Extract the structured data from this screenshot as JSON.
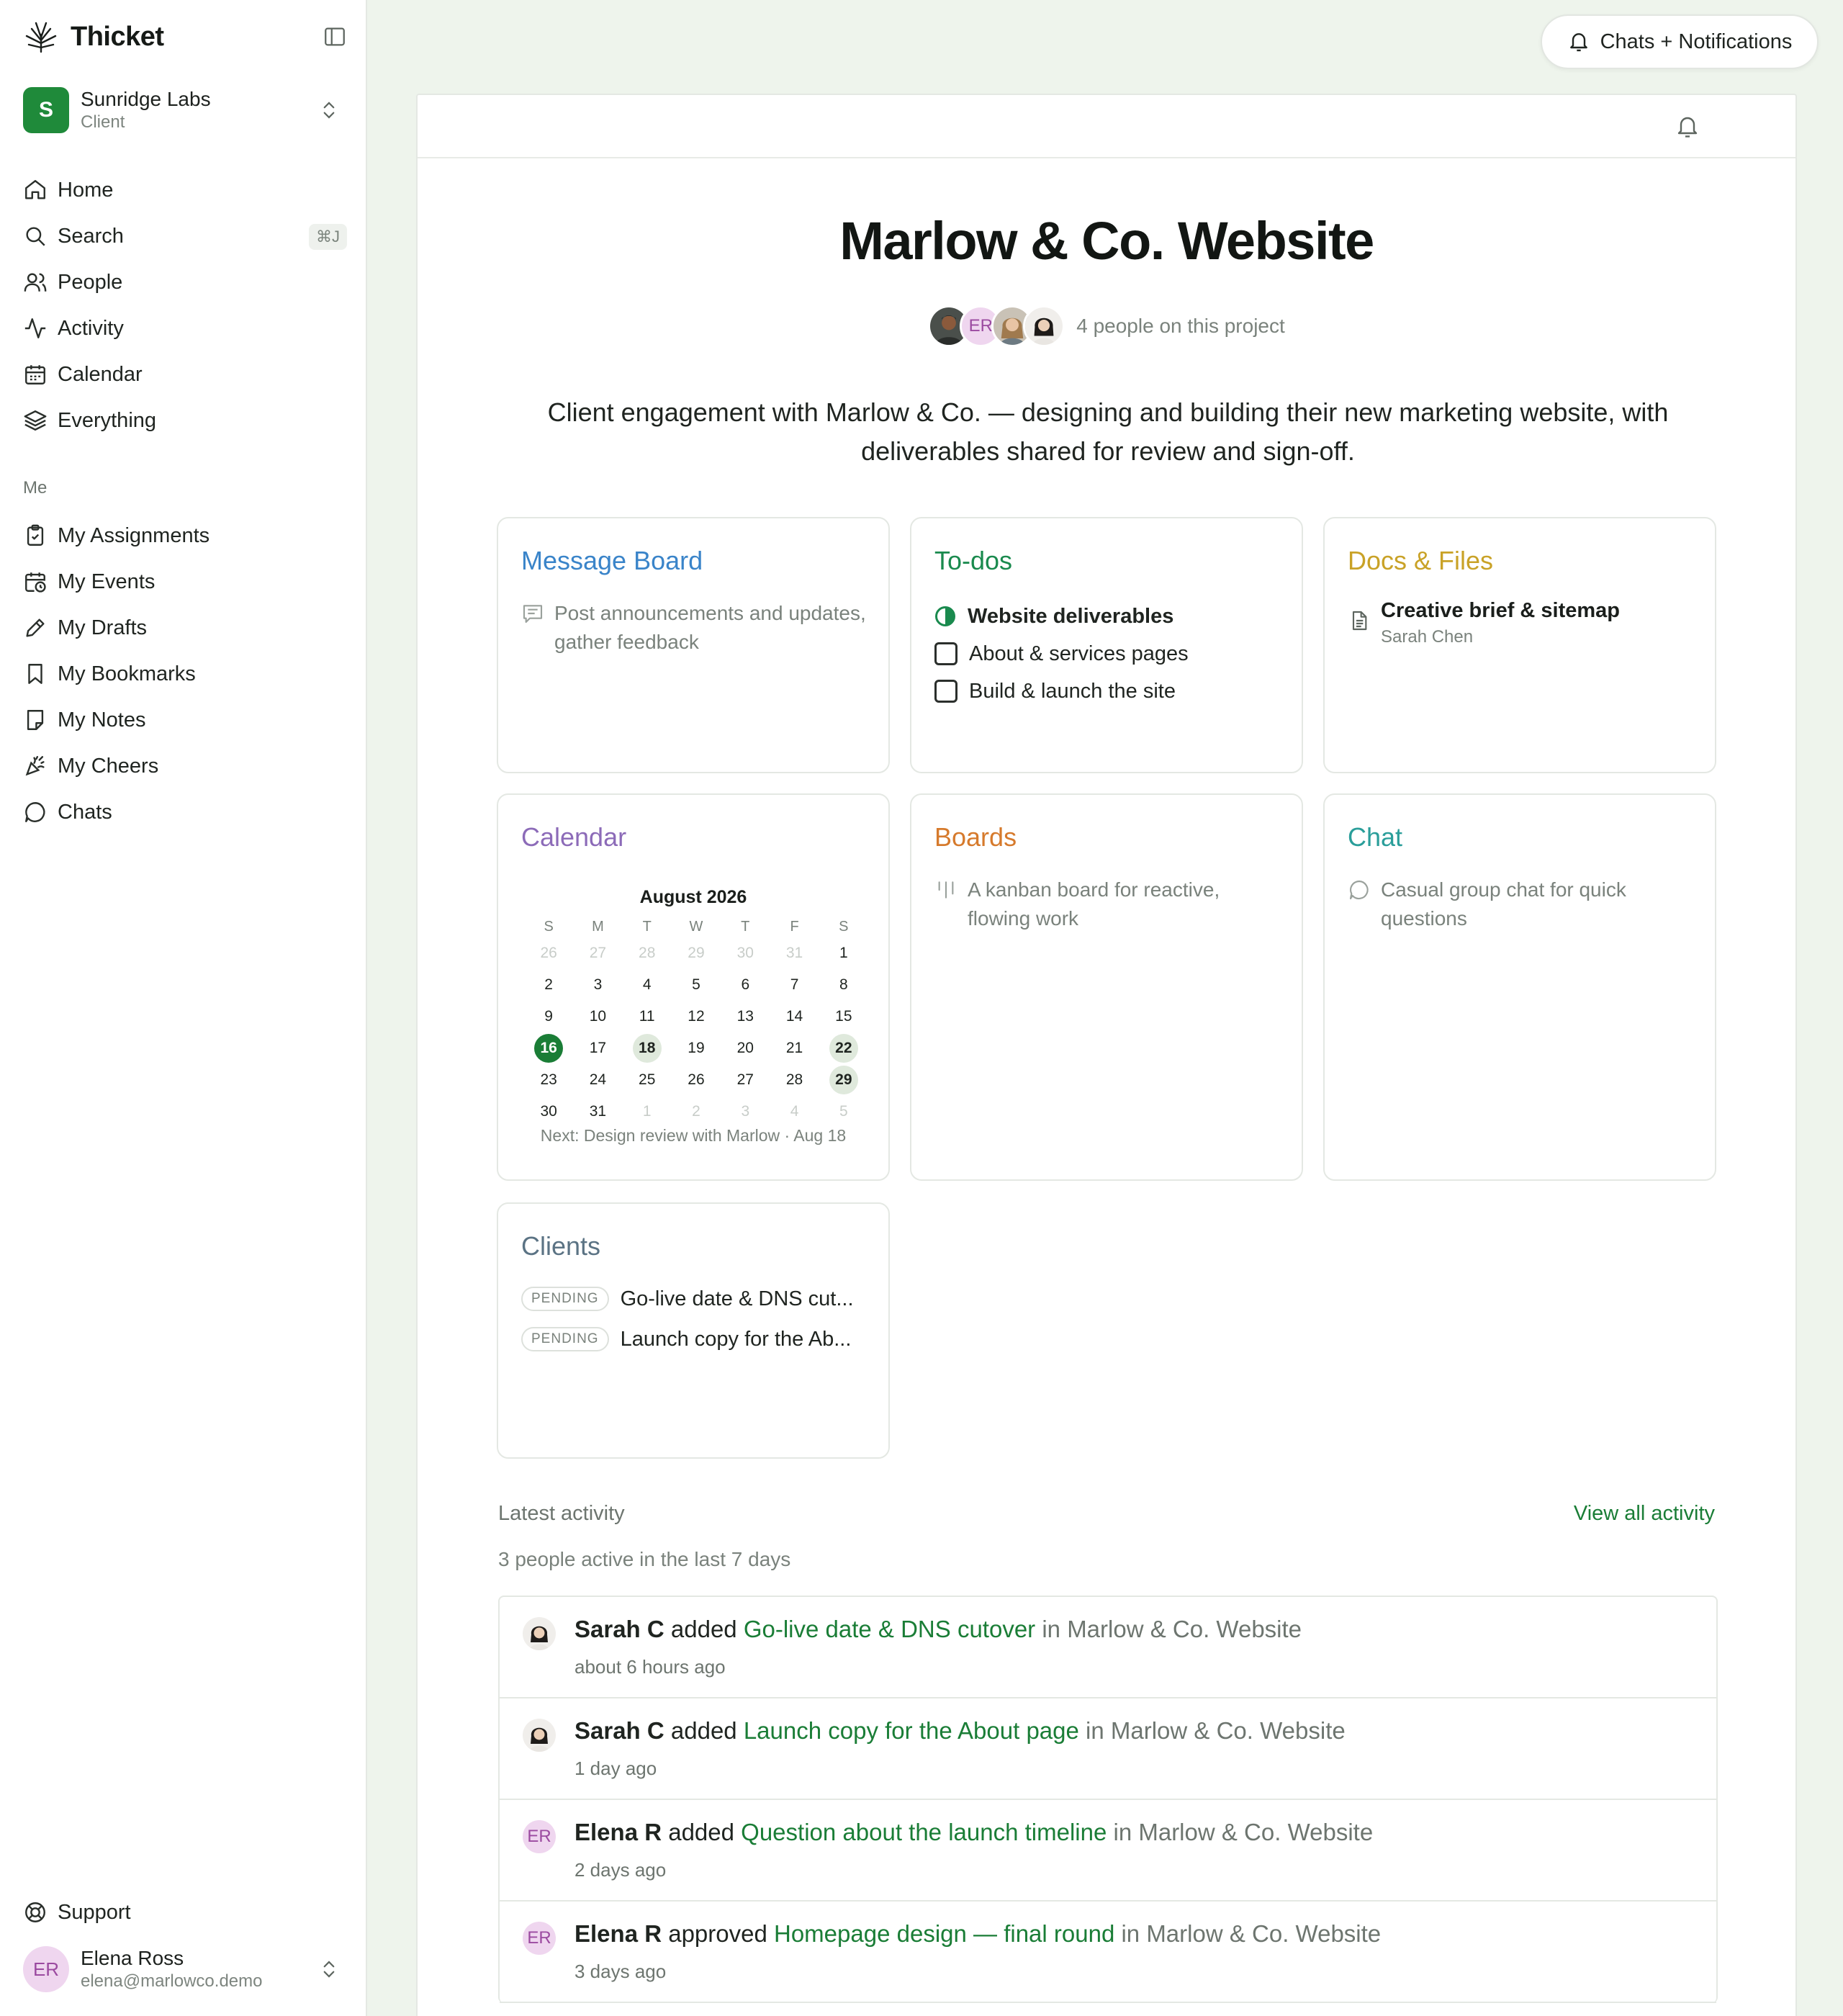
{
  "app": {
    "name": "Thicket"
  },
  "workspace": {
    "initial": "S",
    "name": "Sunridge Labs",
    "role": "Client"
  },
  "nav": [
    {
      "label": "Home",
      "icon": "home-icon"
    },
    {
      "label": "Search",
      "icon": "search-icon",
      "shortcut": "⌘J"
    },
    {
      "label": "People",
      "icon": "people-icon"
    },
    {
      "label": "Activity",
      "icon": "activity-icon"
    },
    {
      "label": "Calendar",
      "icon": "calendar-icon"
    },
    {
      "label": "Everything",
      "icon": "layers-icon"
    }
  ],
  "me_section": {
    "label": "Me",
    "items": [
      {
        "label": "My Assignments",
        "icon": "clipboard-check-icon"
      },
      {
        "label": "My Events",
        "icon": "calendar-clock-icon"
      },
      {
        "label": "My Drafts",
        "icon": "pencil-icon"
      },
      {
        "label": "My Bookmarks",
        "icon": "bookmark-icon"
      },
      {
        "label": "My Notes",
        "icon": "note-icon"
      },
      {
        "label": "My Cheers",
        "icon": "party-popper-icon"
      },
      {
        "label": "Chats",
        "icon": "chat-bubble-icon"
      }
    ]
  },
  "support": {
    "label": "Support"
  },
  "user": {
    "initials": "ER",
    "name": "Elena Ross",
    "email": "elena@marlowco.demo"
  },
  "top": {
    "notifications_label": "Chats + Notifications"
  },
  "project": {
    "title": "Marlow & Co. Website",
    "people_text": "4 people on this project",
    "avatar_er": "ER",
    "description": "Client engagement with Marlow & Co. — designing and building their new marketing website, with deliverables shared for review and sign-off."
  },
  "cards": {
    "message_board": {
      "title": "Message Board",
      "desc": "Post announcements and updates, gather feedback",
      "color": "#3a84c9"
    },
    "todos": {
      "title": "To-dos",
      "color": "#1a8a4e",
      "list_title": "Website deliverables",
      "items": [
        "About & services pages",
        "Build & launch the site"
      ]
    },
    "docs": {
      "title": "Docs & Files",
      "color": "#c9a227",
      "doc_name": "Creative brief & sitemap",
      "doc_author": "Sarah Chen"
    },
    "calendar": {
      "title": "Calendar",
      "color": "#8c6bb8",
      "month": "August 2026",
      "weekdays": [
        "S",
        "M",
        "T",
        "W",
        "T",
        "F",
        "S"
      ],
      "days": [
        {
          "d": "26",
          "m": true
        },
        {
          "d": "27",
          "m": true
        },
        {
          "d": "28",
          "m": true
        },
        {
          "d": "29",
          "m": true
        },
        {
          "d": "30",
          "m": true
        },
        {
          "d": "31",
          "m": true
        },
        {
          "d": "1"
        },
        {
          "d": "2"
        },
        {
          "d": "3"
        },
        {
          "d": "4"
        },
        {
          "d": "5"
        },
        {
          "d": "6"
        },
        {
          "d": "7"
        },
        {
          "d": "8"
        },
        {
          "d": "9"
        },
        {
          "d": "10"
        },
        {
          "d": "11"
        },
        {
          "d": "12"
        },
        {
          "d": "13"
        },
        {
          "d": "14"
        },
        {
          "d": "15"
        },
        {
          "d": "16",
          "today": true
        },
        {
          "d": "17"
        },
        {
          "d": "18",
          "event": true
        },
        {
          "d": "19"
        },
        {
          "d": "20"
        },
        {
          "d": "21"
        },
        {
          "d": "22",
          "event": true
        },
        {
          "d": "23"
        },
        {
          "d": "24"
        },
        {
          "d": "25"
        },
        {
          "d": "26"
        },
        {
          "d": "27"
        },
        {
          "d": "28"
        },
        {
          "d": "29",
          "event": true
        },
        {
          "d": "30"
        },
        {
          "d": "31"
        },
        {
          "d": "1",
          "m": true
        },
        {
          "d": "2",
          "m": true
        },
        {
          "d": "3",
          "m": true
        },
        {
          "d": "4",
          "m": true
        },
        {
          "d": "5",
          "m": true
        }
      ],
      "next": "Next: Design review with Marlow · Aug 18"
    },
    "boards": {
      "title": "Boards",
      "color": "#d67a2c",
      "desc": "A kanban board for reactive, flowing work"
    },
    "chat": {
      "title": "Chat",
      "color": "#2a9e9a",
      "desc": "Casual group chat for quick questions"
    },
    "clients": {
      "title": "Clients",
      "color": "#5b7384",
      "items": [
        {
          "badge": "PENDING",
          "text": "Go-live date & DNS cut..."
        },
        {
          "badge": "PENDING",
          "text": "Launch copy for the Ab..."
        }
      ]
    }
  },
  "activity": {
    "label": "Latest activity",
    "view_all": "View all activity",
    "subtitle": "3 people active in the last 7 days",
    "items": [
      {
        "avatar": "photo",
        "who": "Sarah C",
        "verb": "added",
        "what": "Go-live date & DNS cutover",
        "in": "in Marlow & Co. Website",
        "time": "about 6 hours ago"
      },
      {
        "avatar": "photo",
        "who": "Sarah C",
        "verb": "added",
        "what": "Launch copy for the About page",
        "in": "in Marlow & Co. Website",
        "time": "1 day ago"
      },
      {
        "avatar": "ER",
        "who": "Elena R",
        "verb": "added",
        "what": "Question about the launch timeline",
        "in": "in Marlow & Co. Website",
        "time": "2 days ago"
      },
      {
        "avatar": "ER",
        "who": "Elena R",
        "verb": "approved",
        "what": "Homepage design — final round",
        "in": "in Marlow & Co. Website",
        "time": "3 days ago"
      }
    ]
  }
}
